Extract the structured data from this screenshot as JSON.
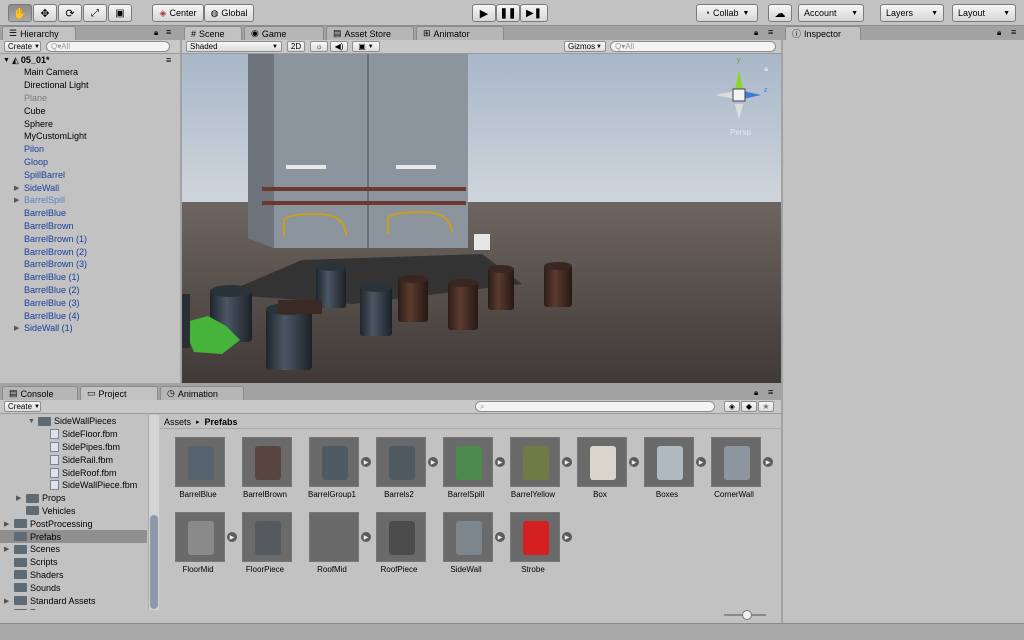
{
  "toolbar": {
    "tools": [
      "hand-icon",
      "move-icon",
      "rotate-icon",
      "scale-icon",
      "rect-icon"
    ],
    "pivot": "Center",
    "space": "Global",
    "collab": "Collab",
    "account": "Account",
    "layers": "Layers",
    "layout": "Layout"
  },
  "hierarchy": {
    "tab": "Hierarchy",
    "create": "Create",
    "search_placeholder": "Q▾All",
    "scene": "05_01*",
    "items": [
      {
        "label": "Main Camera",
        "style": "normal",
        "expandable": false
      },
      {
        "label": "Directional Light",
        "style": "normal",
        "expandable": false
      },
      {
        "label": "Plane",
        "style": "gray",
        "expandable": false
      },
      {
        "label": "Cube",
        "style": "normal",
        "expandable": false
      },
      {
        "label": "Sphere",
        "style": "normal",
        "expandable": false
      },
      {
        "label": "MyCustomLight",
        "style": "normal",
        "expandable": false
      },
      {
        "label": "Pilon",
        "style": "blue",
        "expandable": false
      },
      {
        "label": "Gloop",
        "style": "blue",
        "expandable": false
      },
      {
        "label": "SpillBarrel",
        "style": "blue",
        "expandable": false
      },
      {
        "label": "SideWall",
        "style": "blue",
        "expandable": true
      },
      {
        "label": "BarrelSpill",
        "style": "pblue",
        "expandable": true
      },
      {
        "label": "BarrelBlue",
        "style": "blue",
        "expandable": false
      },
      {
        "label": "BarrelBrown",
        "style": "blue",
        "expandable": false
      },
      {
        "label": "BarrelBrown (1)",
        "style": "blue",
        "expandable": false
      },
      {
        "label": "BarrelBrown (2)",
        "style": "blue",
        "expandable": false
      },
      {
        "label": "BarrelBrown (3)",
        "style": "blue",
        "expandable": false
      },
      {
        "label": "BarrelBlue (1)",
        "style": "blue",
        "expandable": false
      },
      {
        "label": "BarrelBlue (2)",
        "style": "blue",
        "expandable": false
      },
      {
        "label": "BarrelBlue (3)",
        "style": "blue",
        "expandable": false
      },
      {
        "label": "BarrelBlue (4)",
        "style": "blue",
        "expandable": false
      },
      {
        "label": "SideWall (1)",
        "style": "blue",
        "expandable": true
      }
    ]
  },
  "scene": {
    "tabs": [
      "Scene",
      "Game",
      "Asset Store",
      "Animator"
    ],
    "shading": "Shaded",
    "mode2d": "2D",
    "gizmos": "Gizmos",
    "search_placeholder": "Q▾All",
    "persp": "Persp",
    "axis_y": "y",
    "axis_z": "z"
  },
  "bottom": {
    "tabs": [
      "Console",
      "Project",
      "Animation"
    ],
    "create": "Create",
    "breadcrumb_root": "Assets",
    "breadcrumb_sep": "▸",
    "breadcrumb_current": "Prefabs",
    "tree": [
      {
        "label": "SideWallPieces",
        "type": "folder",
        "indent": 2,
        "open": true
      },
      {
        "label": "SideFloor.fbm",
        "type": "file",
        "indent": 3
      },
      {
        "label": "SidePipes.fbm",
        "type": "file",
        "indent": 3
      },
      {
        "label": "SideRail.fbm",
        "type": "file",
        "indent": 3
      },
      {
        "label": "SideRoof.fbm",
        "type": "file",
        "indent": 3
      },
      {
        "label": "SideWallPiece.fbm",
        "type": "file",
        "indent": 3
      },
      {
        "label": "Props",
        "type": "folder",
        "indent": 1,
        "closed": true
      },
      {
        "label": "Vehicles",
        "type": "folder",
        "indent": 1
      },
      {
        "label": "PostProcessing",
        "type": "folder",
        "indent": 0,
        "closed": true
      },
      {
        "label": "Prefabs",
        "type": "folder",
        "indent": 0,
        "selected": true
      },
      {
        "label": "Scenes",
        "type": "folder",
        "indent": 0,
        "closed": true
      },
      {
        "label": "Scripts",
        "type": "folder",
        "indent": 0
      },
      {
        "label": "Shaders",
        "type": "folder",
        "indent": 0
      },
      {
        "label": "Sounds",
        "type": "folder",
        "indent": 0
      },
      {
        "label": "Standard Assets",
        "type": "folder",
        "indent": 0,
        "closed": true
      },
      {
        "label": "Textures",
        "type": "folder",
        "indent": 0
      }
    ],
    "assets": [
      {
        "label": "BarrelBlue",
        "play": false,
        "color": "#56626d"
      },
      {
        "label": "BarrelBrown",
        "play": false,
        "color": "#5a4640"
      },
      {
        "label": "BarrelGroup1",
        "play": true,
        "color": "#505a62"
      },
      {
        "label": "Barrels2",
        "play": true,
        "color": "#505a62"
      },
      {
        "label": "BarrelSpill",
        "play": true,
        "color": "#4d8a4d"
      },
      {
        "label": "BarrelYellow",
        "play": true,
        "color": "#6f7a45"
      },
      {
        "label": "Box",
        "play": true,
        "color": "#d8d6cc"
      },
      {
        "label": "Boxes",
        "play": true,
        "color": "#aebac0"
      },
      {
        "label": "CornerWall",
        "play": true,
        "color": "#8d969e"
      },
      {
        "label": "FloorMid",
        "play": true,
        "color": "#8a8a8a"
      },
      {
        "label": "FloorPiece",
        "play": false,
        "color": "#555a60"
      },
      {
        "label": "RoofMid",
        "play": true,
        "color": "#6a6a6a"
      },
      {
        "label": "RoofPiece",
        "play": false,
        "color": "#4c4c4c"
      },
      {
        "label": "SideWall",
        "play": true,
        "color": "#7e868d"
      },
      {
        "label": "Strobe",
        "play": true,
        "color": "#d42020"
      }
    ]
  },
  "inspector": {
    "tab": "Inspector"
  }
}
